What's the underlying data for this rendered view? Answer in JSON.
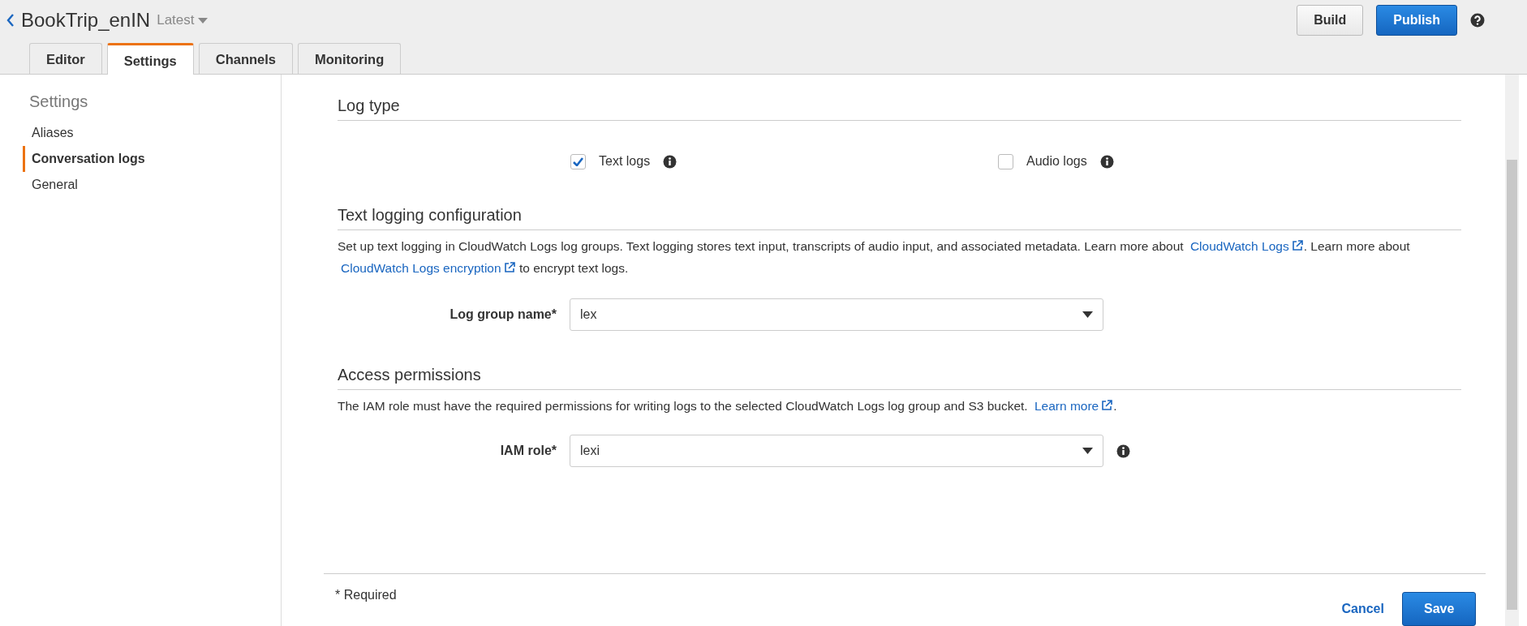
{
  "header": {
    "back_label": "BookTrip_enIN",
    "version": "Latest",
    "buttons": [
      {
        "label": "Build",
        "kind": "default"
      },
      {
        "label": "Publish",
        "kind": "primary"
      }
    ]
  },
  "tabs": [
    {
      "label": "Editor",
      "selected": false
    },
    {
      "label": "Settings",
      "selected": true
    },
    {
      "label": "Channels",
      "selected": false
    },
    {
      "label": "Monitoring",
      "selected": false
    }
  ],
  "sidebar": {
    "title": "Settings",
    "items": [
      {
        "label": "Aliases",
        "selected": false
      },
      {
        "label": "Conversation logs",
        "selected": true
      },
      {
        "label": "General",
        "selected": false
      }
    ]
  },
  "log_type": {
    "heading": "Log type",
    "options": [
      {
        "label": "Text logs",
        "checked": true
      },
      {
        "label": "Audio logs",
        "checked": false
      }
    ]
  },
  "text_logging": {
    "heading": "Text logging configuration",
    "description": [
      {
        "kind": "text",
        "text": "Set up text logging in CloudWatch Logs log groups. Text logging stores text input, transcripts of audio input, and associated metadata. Learn more about "
      },
      {
        "kind": "link",
        "text": "CloudWatch Logs"
      },
      {
        "kind": "text",
        "text": ". Learn more about "
      },
      {
        "kind": "link",
        "text": "CloudWatch Logs encryption"
      },
      {
        "kind": "text",
        "text": " to encrypt text logs."
      }
    ],
    "field": {
      "label": "Log group name*",
      "value": "lex",
      "info": false
    }
  },
  "access": {
    "heading": "Access permissions",
    "description": [
      {
        "kind": "text",
        "text": "The IAM role must have the required permissions for writing logs to the selected CloudWatch Logs log group and S3 bucket. "
      },
      {
        "kind": "link",
        "text": "Learn more"
      },
      {
        "kind": "text",
        "text": "."
      }
    ],
    "field": {
      "label": "IAM role*",
      "value": "lexi",
      "info": true
    }
  },
  "footer": {
    "note": "* Required",
    "cancel": "Cancel",
    "save": "Save"
  }
}
